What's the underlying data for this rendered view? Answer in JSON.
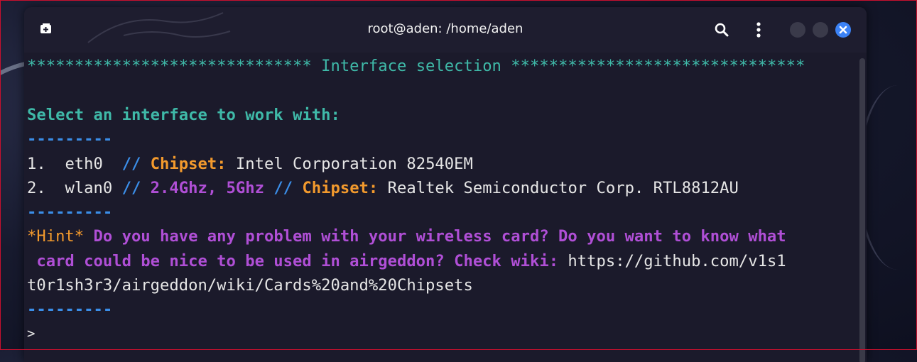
{
  "window": {
    "title": "root@aden: /home/aden",
    "close_color": "#3b82f6"
  },
  "icons": {
    "new_tab": "new-tab-icon",
    "search": "search-icon",
    "menu": "kebab-menu-icon",
    "close": "close-icon"
  },
  "terminal": {
    "header": {
      "left_stars": "******************************",
      "label": " Interface selection ",
      "right_stars": "*******************************"
    },
    "prompt_heading": "Select an interface to work with:",
    "separator": "---------",
    "interfaces": [
      {
        "num": "1.  ",
        "name": "eth0  ",
        "sep1": "// ",
        "chipset_label": "Chipset:",
        "chipset": " Intel Corporation 82540EM"
      },
      {
        "num": "2.  ",
        "name": "wlan0 ",
        "sep1": "// ",
        "bands": "2.4Ghz, 5Ghz",
        "sep2": " // ",
        "chipset_label": "Chipset:",
        "chipset": " Realtek Semiconductor Corp. RTL8812AU"
      }
    ],
    "hint": {
      "tag": "*Hint*",
      "line1": " Do you have any problem with your wireless card? Do you want to know what",
      "line2": " card could be nice to be used in airgeddon? Check wiki:",
      "url_part1": " https://github.com/v1s1",
      "url_part2": "t0r1sh3r3/airgeddon/wiki/Cards%20and%20Chipsets"
    },
    "input_prompt": ">"
  }
}
